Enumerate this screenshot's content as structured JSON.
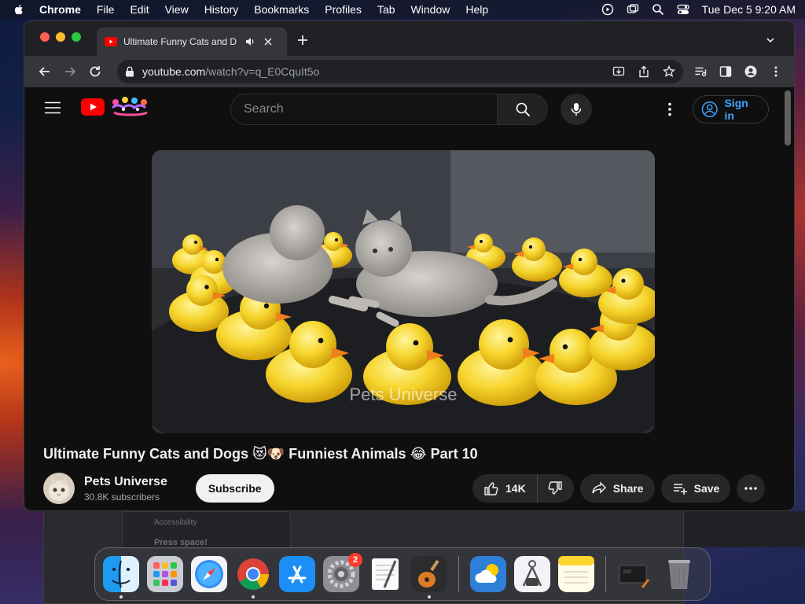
{
  "menubar": {
    "app_name": "Chrome",
    "items": [
      "File",
      "Edit",
      "View",
      "History",
      "Bookmarks",
      "Profiles",
      "Tab",
      "Window",
      "Help"
    ],
    "clock": "Tue Dec 5  9:20 AM"
  },
  "background_window": {
    "line1": "Accessibility",
    "line2": "Press space!"
  },
  "browser": {
    "tab_title": "Ultimate Funny Cats and D",
    "url_host": "youtube.com",
    "url_path": "/watch?v=q_E0CquIt5o"
  },
  "youtube": {
    "search_placeholder": "Search",
    "sign_in_label": "Sign in",
    "video": {
      "watermark": "Pets Universe",
      "title_part1": "Ultimate Funny Cats and Dogs ",
      "title_emoji1": "😻🐶",
      "title_part2": " Funniest Animals ",
      "title_emoji2": "😂",
      "title_part3": " Part 10"
    },
    "channel": {
      "name": "Pets Universe",
      "subscribers": "30.8K subscribers",
      "subscribe_label": "Subscribe"
    },
    "actions": {
      "like_count": "14K",
      "share_label": "Share",
      "save_label": "Save"
    }
  },
  "dock": {
    "settings_badge": "2",
    "apps": [
      "finder-icon",
      "launchpad-icon",
      "safari-icon",
      "chrome-icon",
      "app-store-icon",
      "system-settings-icon",
      "textedit-icon",
      "garageband-icon",
      "weather-icon",
      "preview-icon",
      "notes-icon",
      "screen-icon",
      "trash-icon"
    ]
  },
  "colors": {
    "yt_red": "#ff0000",
    "link_blue": "#3ea6ff",
    "page_bg": "#0f0f0f",
    "pill_bg": "#272727"
  }
}
